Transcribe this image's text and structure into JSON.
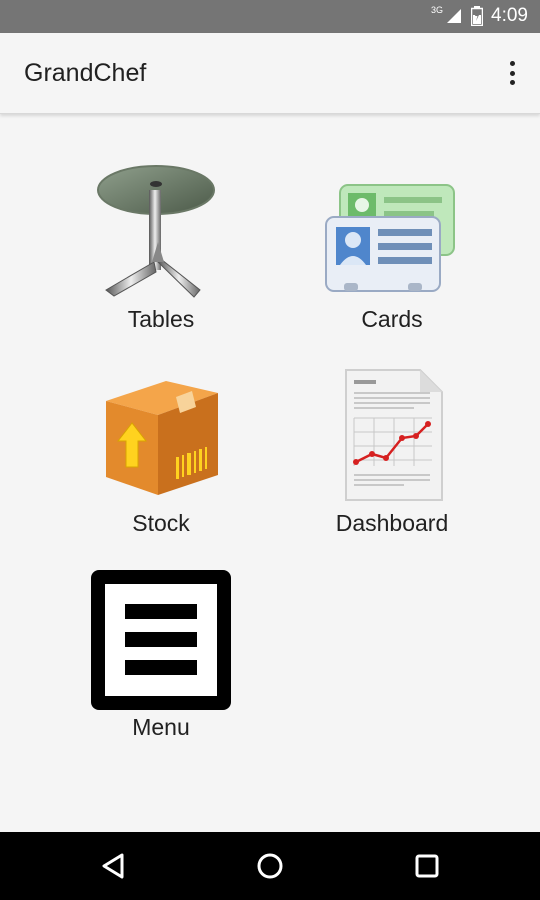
{
  "status_bar": {
    "network": "3G",
    "time": "4:09"
  },
  "app_bar": {
    "title": "GrandChef",
    "overflow_icon": "more-vert-icon"
  },
  "tiles": [
    {
      "label": "Tables",
      "icon": "table-icon"
    },
    {
      "label": "Cards",
      "icon": "cards-icon"
    },
    {
      "label": "Stock",
      "icon": "stock-box-icon"
    },
    {
      "label": "Dashboard",
      "icon": "dashboard-report-icon"
    },
    {
      "label": "Menu",
      "icon": "menu-icon"
    }
  ],
  "nav_bar": {
    "back": "back-icon",
    "home": "home-icon",
    "recents": "recents-icon"
  },
  "colors": {
    "status_bar": "#757575",
    "app_bar": "#f5f5f5",
    "nav_bar": "#000000",
    "accent_arrow": "#ffd21f",
    "box": "#e58a2c"
  }
}
